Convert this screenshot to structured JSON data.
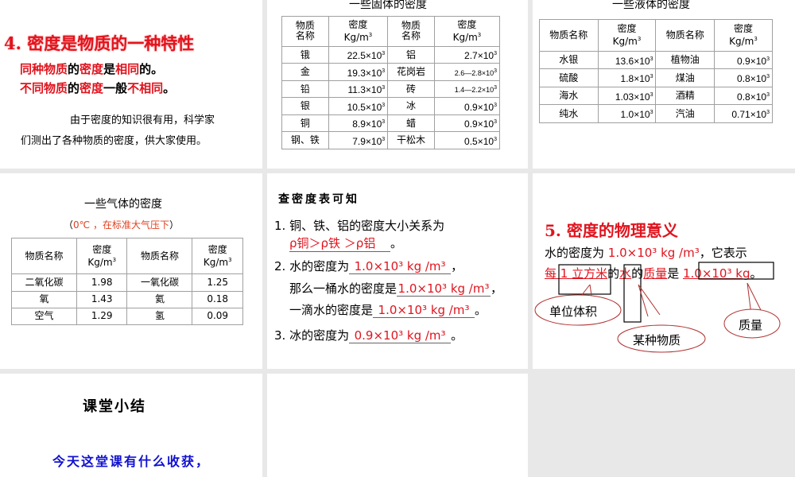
{
  "slide1": {
    "title": "4. 密度是物质的一种特性",
    "line1": [
      [
        "同种物质",
        "red"
      ],
      [
        "的",
        "blk"
      ],
      [
        "密度",
        "red"
      ],
      [
        "是",
        "blk"
      ],
      [
        "相同",
        "red"
      ],
      [
        "的。",
        "blk"
      ]
    ],
    "line2": [
      [
        "不同物质",
        "red"
      ],
      [
        "的",
        "blk"
      ],
      [
        "密度",
        "red"
      ],
      [
        "一般",
        "blk"
      ],
      [
        "不相同",
        "red"
      ],
      [
        "。",
        "blk"
      ]
    ],
    "para1": "由于密度的知识很有用，科学家",
    "para2": "们测出了各种物质的密度，供大家使用。"
  },
  "slide2": {
    "title": "一些固体的密度",
    "headers": [
      "物质\n名称",
      "密度\nKg/m³",
      "物质\n名称",
      "密度\nKg/m³"
    ],
    "rows": [
      [
        "锇",
        "22.5×10³",
        "铝",
        "2.7×10³"
      ],
      [
        "金",
        "19.3×10³",
        "花岗岩",
        "2.6—2.8×10³"
      ],
      [
        "铅",
        "11.3×10³",
        "砖",
        "1.4—2.2×10³"
      ],
      [
        "银",
        "10.5×10³",
        "冰",
        "0.9×10³"
      ],
      [
        "铜",
        "8.9×10³",
        "蜡",
        "0.9×10³"
      ],
      [
        "钢、铁",
        "7.9×10³",
        "干松木",
        "0.5×10³"
      ]
    ]
  },
  "slide3": {
    "title": "一些液体的密度",
    "headers": [
      "物质名称",
      "密度\nKg/m³",
      "物质名称",
      "密度\nKg/m³"
    ],
    "rows": [
      [
        "水银",
        "13.6×10³",
        "植物油",
        "0.9×10³"
      ],
      [
        "硫酸",
        "1.8×10³",
        "煤油",
        "0.8×10³"
      ],
      [
        "海水",
        "1.03×10³",
        "酒精",
        "0.8×10³"
      ],
      [
        "纯水",
        "1.0×10³",
        "汽油",
        "0.71×10³"
      ]
    ]
  },
  "slide4": {
    "title": "一些气体的密度",
    "subtitle_open": "（",
    "subtitle": "0℃ ，在标准大气压下",
    "subtitle_close": "）",
    "headers": [
      "物质名称",
      "密度\nKg/m³",
      "物质名称",
      "密度\nKg/m³"
    ],
    "rows": [
      [
        "二氧化碳",
        "1.98",
        "一氧化碳",
        "1.25"
      ],
      [
        "氧",
        "1.43",
        "氦",
        "0.18"
      ],
      [
        "空气",
        "1.29",
        "氢",
        "0.09"
      ]
    ]
  },
  "slide5": {
    "heading": "查密度表可知",
    "q1": "1. 铜、铁、铝的密度大小关系为",
    "a1": "ρ铜＞ρ铁 ＞ρ铝",
    "q2": "2. 水的密度为",
    "a2": "1.0×10³ kg /m³",
    "q2b": "那么一桶水的密度是",
    "a2b": "1.0×10³ kg /m³",
    "q2c": "一滴水的密度是",
    "a2c": "1.0×10³ kg /m³",
    "q3": "3. 冰的密度为",
    "a3": "0.9×10³ kg /m³",
    "comma": "，",
    "period": "。"
  },
  "slide6": {
    "title": "5. 密度的物理意义",
    "line1_a": "水的密度为 ",
    "line1_val": "1.0×10³ kg /m³",
    "line1_b": "，它表示",
    "line2": [
      [
        "每",
        "red"
      ],
      [
        " 1 ",
        "red"
      ],
      [
        "立方米",
        "red"
      ],
      [
        "的",
        "blk"
      ],
      [
        "水",
        "red"
      ],
      [
        "的",
        "blk"
      ],
      [
        "质量",
        "red"
      ],
      [
        "是 ",
        "blk"
      ],
      [
        "1.0×10³ kg",
        "red"
      ],
      [
        "。",
        "blk"
      ]
    ],
    "callout_volume": "单位体积",
    "callout_substance": "某种物质",
    "callout_mass": "质量"
  },
  "slide7": {
    "title": "课堂小结",
    "question": "今天这堂课有什么收获，"
  },
  "colors": {
    "accent_red": "#e0141e",
    "blue": "#1010d0",
    "background": "#e8e8e8"
  }
}
